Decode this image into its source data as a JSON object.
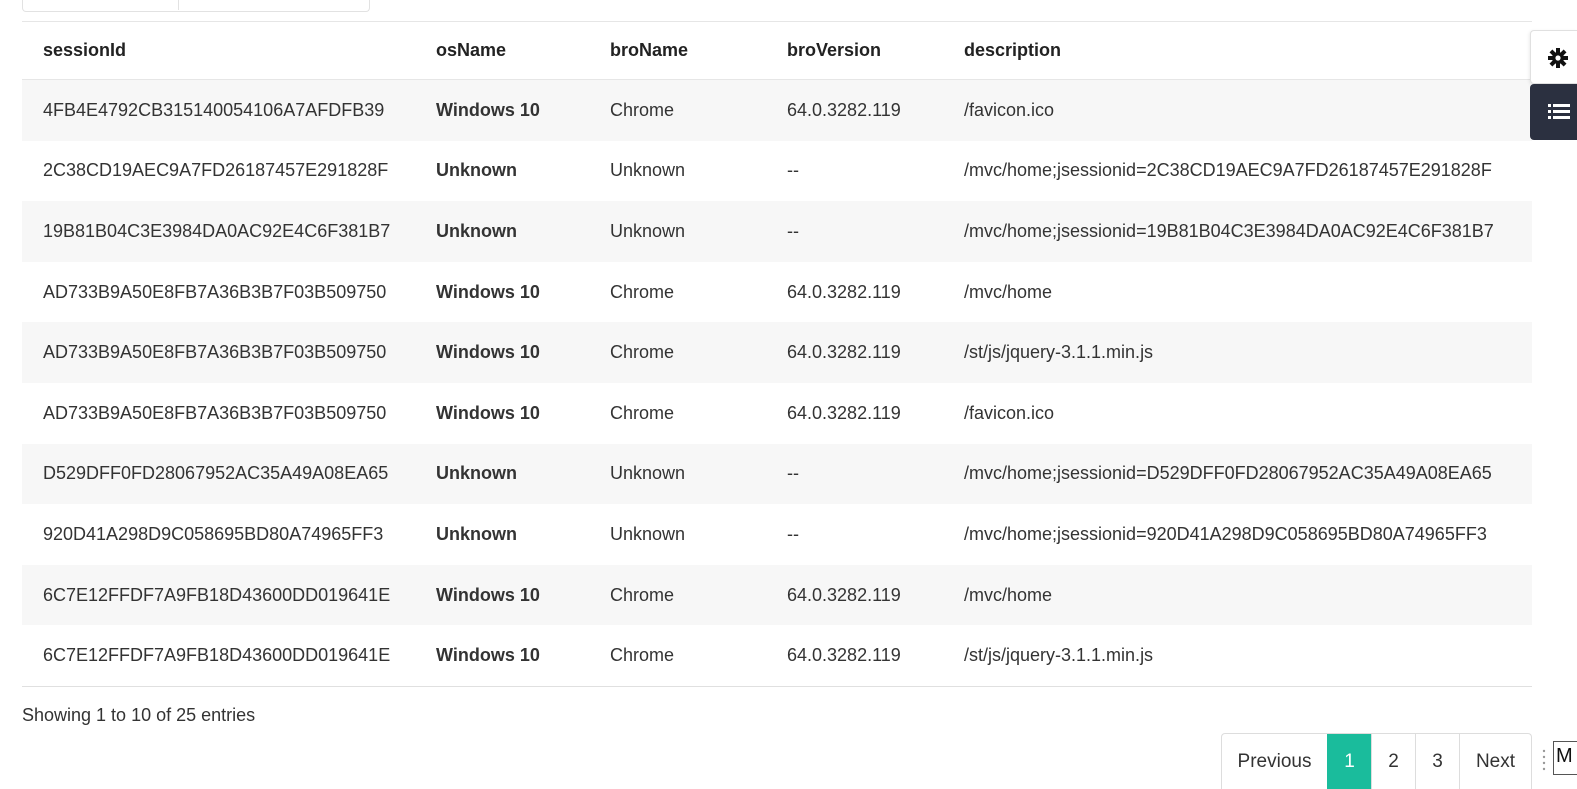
{
  "table": {
    "columns": [
      "sessionId",
      "osName",
      "broName",
      "broVersion",
      "description"
    ],
    "rows": [
      {
        "sessionId": "4FB4E4792CB315140054106A7AFDFB39",
        "osName": "Windows 10",
        "broName": "Chrome",
        "broVersion": "64.0.3282.119",
        "description": "/favicon.ico"
      },
      {
        "sessionId": "2C38CD19AEC9A7FD26187457E291828F",
        "osName": "Unknown",
        "broName": "Unknown",
        "broVersion": "--",
        "description": "/mvc/home;jsessionid=2C38CD19AEC9A7FD26187457E291828F"
      },
      {
        "sessionId": "19B81B04C3E3984DA0AC92E4C6F381B7",
        "osName": "Unknown",
        "broName": "Unknown",
        "broVersion": "--",
        "description": "/mvc/home;jsessionid=19B81B04C3E3984DA0AC92E4C6F381B7"
      },
      {
        "sessionId": "AD733B9A50E8FB7A36B3B7F03B509750",
        "osName": "Windows 10",
        "broName": "Chrome",
        "broVersion": "64.0.3282.119",
        "description": "/mvc/home"
      },
      {
        "sessionId": "AD733B9A50E8FB7A36B3B7F03B509750",
        "osName": "Windows 10",
        "broName": "Chrome",
        "broVersion": "64.0.3282.119",
        "description": "/st/js/jquery-3.1.1.min.js"
      },
      {
        "sessionId": "AD733B9A50E8FB7A36B3B7F03B509750",
        "osName": "Windows 10",
        "broName": "Chrome",
        "broVersion": "64.0.3282.119",
        "description": "/favicon.ico"
      },
      {
        "sessionId": "D529DFF0FD28067952AC35A49A08EA65",
        "osName": "Unknown",
        "broName": "Unknown",
        "broVersion": "--",
        "description": "/mvc/home;jsessionid=D529DFF0FD28067952AC35A49A08EA65"
      },
      {
        "sessionId": "920D41A298D9C058695BD80A74965FF3",
        "osName": "Unknown",
        "broName": "Unknown",
        "broVersion": "--",
        "description": "/mvc/home;jsessionid=920D41A298D9C058695BD80A74965FF3"
      },
      {
        "sessionId": "6C7E12FFDF7A9FB18D43600DD019641E",
        "osName": "Windows 10",
        "broName": "Chrome",
        "broVersion": "64.0.3282.119",
        "description": "/mvc/home"
      },
      {
        "sessionId": "6C7E12FFDF7A9FB18D43600DD019641E",
        "osName": "Windows 10",
        "broName": "Chrome",
        "broVersion": "64.0.3282.119",
        "description": "/st/js/jquery-3.1.1.min.js"
      }
    ]
  },
  "info_text": "Showing 1 to 10 of 25 entries",
  "pagination": {
    "previous": "Previous",
    "pages": [
      "1",
      "2",
      "3"
    ],
    "active_page": "1",
    "next": "Next"
  },
  "tools": {
    "settings_icon": "gear-icon",
    "list_icon": "list-icon"
  },
  "corner_label": "M",
  "colors": {
    "os_text": "#1a8a1a",
    "active_page": "#1abc9c",
    "tool_dark": "#2b3040",
    "stripe": "#f7f7f7"
  }
}
